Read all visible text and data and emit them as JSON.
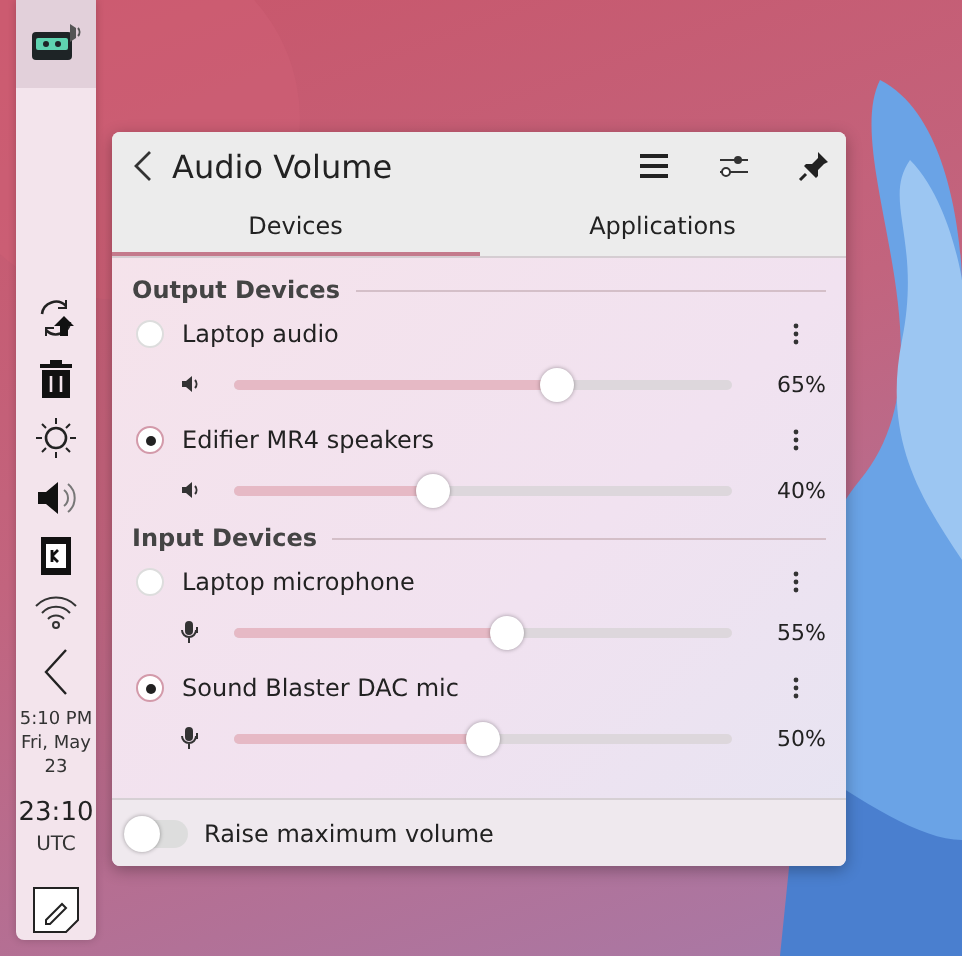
{
  "clock": {
    "local_lines": [
      "5:10 PM",
      "Fri, May",
      "23"
    ],
    "time": "23:10",
    "zone": "UTC"
  },
  "popup": {
    "title": "Audio Volume",
    "tabs": [
      {
        "label": "Devices",
        "selected": true
      },
      {
        "label": "Applications",
        "selected": false
      }
    ],
    "sections": [
      {
        "heading": "Output Devices",
        "kind": "output",
        "devices": [
          {
            "name": "Laptop audio",
            "selected": false,
            "level": 0.65,
            "reading": "65%"
          },
          {
            "name": "Edifier MR4 speakers",
            "selected": true,
            "level": 0.4,
            "reading": "40%"
          }
        ]
      },
      {
        "heading": "Input Devices",
        "kind": "input",
        "devices": [
          {
            "name": "Laptop microphone",
            "selected": false,
            "level": 0.55,
            "reading": "55%"
          },
          {
            "name": "Sound Blaster DAC mic",
            "selected": true,
            "level": 0.5,
            "reading": "50%"
          }
        ]
      }
    ],
    "raise_max": {
      "label": "Raise maximum volume",
      "on": false
    }
  }
}
